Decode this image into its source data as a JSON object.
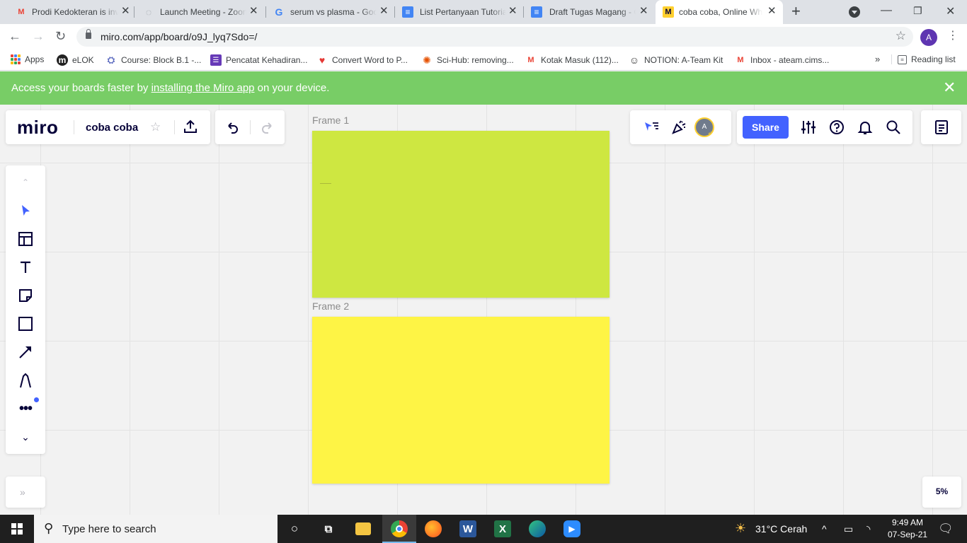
{
  "browser": {
    "tabs": [
      {
        "title": "Prodi Kedokteran is inviting you to a scheduled Zoom meeting",
        "icon": "gmail-icon",
        "color": "#ea4335",
        "glyph": "M"
      },
      {
        "title": "Launch Meeting - Zoom",
        "icon": "globe-icon",
        "color": "#5f6368",
        "glyph": "◌"
      },
      {
        "title": "serum vs plasma - Google Search",
        "icon": "google-icon",
        "color": "#4285f4",
        "glyph": "G"
      },
      {
        "title": "List Pertanyaan Tutorial",
        "icon": "docs-icon",
        "color": "#4285f4",
        "glyph": "≡"
      },
      {
        "title": "Draft Tugas Magang - Google Docs",
        "icon": "docs-icon",
        "color": "#4285f4",
        "glyph": "≡"
      },
      {
        "title": "coba coba, Online Whiteboard for Visual Collaboration",
        "icon": "miro-icon",
        "color": "#ffd02f",
        "glyph": "M"
      }
    ],
    "active_tab": 5,
    "new_tab": "+",
    "url": "miro.com/app/board/o9J_lyq7Sdo=/",
    "profile_initial": "A",
    "bookmarks": [
      {
        "label": "Apps",
        "icon": "apps-grid-icon"
      },
      {
        "label": "eLOK",
        "icon": "elok-icon",
        "glyph": "m"
      },
      {
        "label": "Course: Block B.1 -...",
        "icon": "course-icon",
        "glyph": "⛭"
      },
      {
        "label": "Pencatat Kehadiran...",
        "icon": "forms-icon",
        "glyph": "☰"
      },
      {
        "label": "Convert Word to P...",
        "icon": "heart-icon",
        "glyph": "♥"
      },
      {
        "label": "Sci-Hub: removing...",
        "icon": "scihub-icon",
        "glyph": "✺"
      },
      {
        "label": "Kotak Masuk (112)...",
        "icon": "gmail-icon",
        "glyph": "M"
      },
      {
        "label": "NOTION: A-Team Kit",
        "icon": "notion-icon",
        "glyph": "☺"
      },
      {
        "label": "Inbox - ateam.cims...",
        "icon": "gmail-icon",
        "glyph": "M"
      }
    ],
    "bookmarks_more": "»",
    "reading_list": "Reading list"
  },
  "banner": {
    "prefix": "Access your boards faster by ",
    "link": "installing the Miro app",
    "suffix": " on your device."
  },
  "miro": {
    "logo": "miro",
    "board_name": "coba coba",
    "share_label": "Share",
    "avatar_initial": "A",
    "zoom": "5%",
    "frames": [
      {
        "label": "Frame 1",
        "color": "#cee741"
      },
      {
        "label": "Frame 2",
        "color": "#fef445"
      }
    ],
    "tools": [
      "select",
      "templates",
      "text",
      "sticky-note",
      "shape",
      "connection-line",
      "pen",
      "more"
    ]
  },
  "taskbar": {
    "search_placeholder": "Type here to search",
    "weather": "31°C  Cerah",
    "time": "9:49 AM",
    "date": "07-Sep-21"
  }
}
